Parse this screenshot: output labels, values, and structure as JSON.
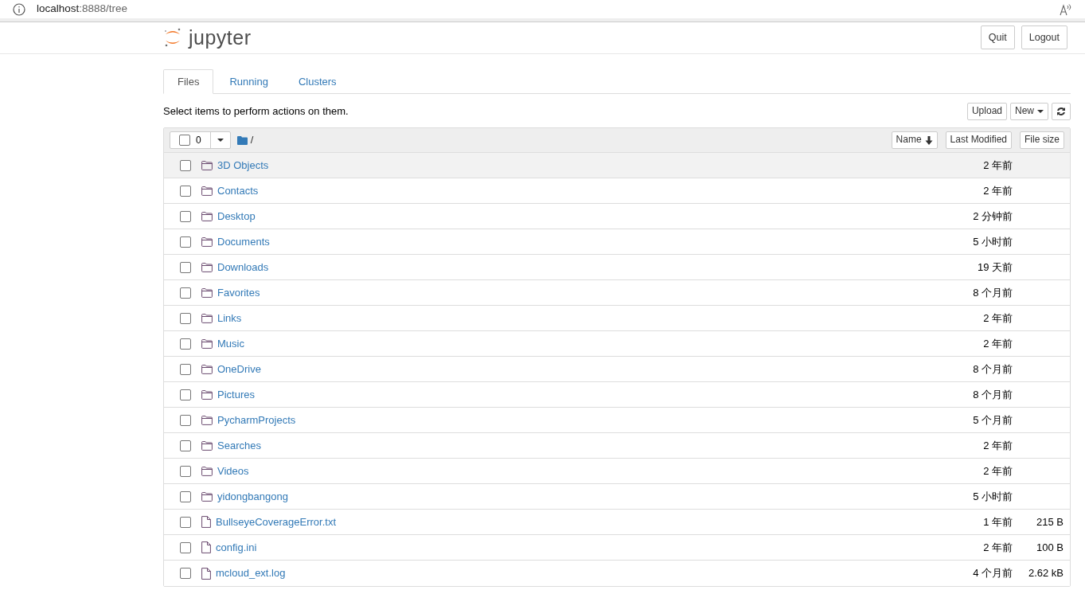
{
  "address_bar": {
    "host": "localhost",
    "path": ":8888/tree"
  },
  "header": {
    "logo_text": "jupyter",
    "buttons": [
      "Quit",
      "Logout"
    ]
  },
  "tabs": [
    {
      "label": "Files",
      "selected": true
    },
    {
      "label": "Running",
      "selected": false
    },
    {
      "label": "Clusters",
      "selected": false
    }
  ],
  "toolbar": {
    "hint": "Select items to perform actions on them.",
    "buttons": [
      "Upload",
      "New"
    ]
  },
  "list_header": {
    "all_checked": false,
    "selected_count": "0",
    "path": "/",
    "sort_buttons": [
      "Name",
      "Last Modified",
      "File size"
    ]
  },
  "items": [
    {
      "kind": "folder",
      "name": "3D Objects",
      "modified": "2 年前",
      "hovered": true,
      "checked": false
    },
    {
      "kind": "folder",
      "name": "Contacts",
      "modified": "2 年前",
      "hovered": false,
      "checked": false
    },
    {
      "kind": "folder",
      "name": "Desktop",
      "modified": "2 分钟前",
      "hovered": false,
      "checked": false
    },
    {
      "kind": "folder",
      "name": "Documents",
      "modified": "5 小时前",
      "hovered": false,
      "checked": false
    },
    {
      "kind": "folder",
      "name": "Downloads",
      "modified": "19 天前",
      "hovered": false,
      "checked": false
    },
    {
      "kind": "folder",
      "name": "Favorites",
      "modified": "8 个月前",
      "hovered": false,
      "checked": false
    },
    {
      "kind": "folder",
      "name": "Links",
      "modified": "2 年前",
      "hovered": false,
      "checked": false
    },
    {
      "kind": "folder",
      "name": "Music",
      "modified": "2 年前",
      "hovered": false,
      "checked": false
    },
    {
      "kind": "folder",
      "name": "OneDrive",
      "modified": "8 个月前",
      "hovered": false,
      "checked": false
    },
    {
      "kind": "folder",
      "name": "Pictures",
      "modified": "8 个月前",
      "hovered": false,
      "checked": false
    },
    {
      "kind": "folder",
      "name": "PycharmProjects",
      "modified": "5 个月前",
      "hovered": false,
      "checked": false
    },
    {
      "kind": "folder",
      "name": "Searches",
      "modified": "2 年前",
      "hovered": false,
      "checked": false
    },
    {
      "kind": "folder",
      "name": "Videos",
      "modified": "2 年前",
      "hovered": false,
      "checked": false
    },
    {
      "kind": "folder",
      "name": "yidongbangong",
      "modified": "5 小时前",
      "hovered": false,
      "checked": false
    },
    {
      "kind": "file",
      "name": "BullseyeCoverageError.txt",
      "modified": "1 年前",
      "size": "215 B",
      "hovered": false,
      "checked": false
    },
    {
      "kind": "file",
      "name": "config.ini",
      "modified": "2 年前",
      "size": "100 B",
      "hovered": false,
      "checked": false
    },
    {
      "kind": "file",
      "name": "mcloud_ext.log",
      "modified": "4 个月前",
      "size": "2.62 kB",
      "hovered": false,
      "checked": false
    }
  ]
}
